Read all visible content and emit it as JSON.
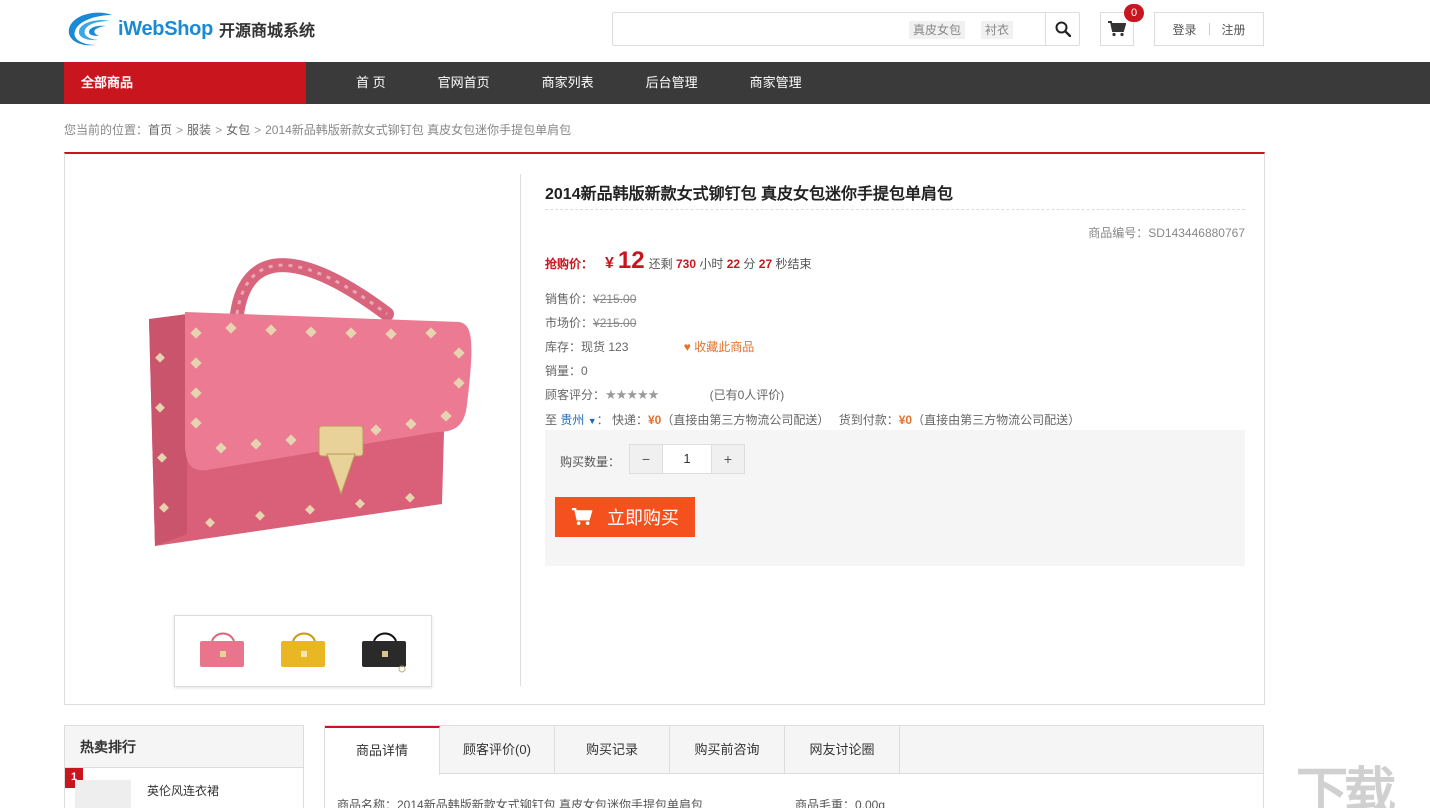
{
  "header": {
    "logo_brand": "iWebShop",
    "logo_sub": "开源商城系统",
    "search_placeholder": "",
    "search_tags": [
      "真皮女包",
      "衬衣"
    ],
    "cart_count": "0",
    "login": "登录",
    "register": "注册"
  },
  "nav": {
    "all_goods": "全部商品",
    "items": [
      "首 页",
      "官网首页",
      "商家列表",
      "后台管理",
      "商家管理"
    ]
  },
  "breadcrumb": {
    "prefix": "您当前的位置：",
    "items": [
      "首页",
      "服装",
      "女包"
    ],
    "current": "2014新品韩版新款女式铆钉包 真皮女包迷你手提包单肩包"
  },
  "product": {
    "title": "2014新品韩版新款女式铆钉包 真皮女包迷你手提包单肩包",
    "code_label": "商品编号：",
    "code": "SD143446880767",
    "rush_label": "抢购价：",
    "rush_currency": "¥",
    "rush_price": "12",
    "cd_prefix": "还剩",
    "cd_hours": "730",
    "cd_hours_unit": "小时",
    "cd_minutes": "22",
    "cd_minutes_unit": "分",
    "cd_seconds": "27",
    "cd_suffix": "秒结束",
    "sale_label": "销售价：",
    "sale_price": "¥215.00",
    "market_label": "市场价：",
    "market_price": "¥215.00",
    "stock_label": "库存：现货",
    "stock": "123",
    "favorite": "收藏此商品",
    "sold_label": "销量：",
    "sold": "0",
    "rating_label": "顾客评分：",
    "rating_stars": 5,
    "rating_text": "(已有0人评价)",
    "ship_to": "至",
    "region": "贵州",
    "express_label": "：  快递：",
    "express_fee": "¥0",
    "express_note": "（直接由第三方物流公司配送）",
    "cod_label": "货到付款：",
    "cod_fee": "¥0",
    "cod_note": "（直接由第三方物流公司配送）",
    "qty_label": "购买数量：",
    "qty_minus": "−",
    "qty_value": "1",
    "qty_plus": "+",
    "buy_now": "立即购买",
    "colors": {
      "bag_main": "#e8758c",
      "thumb_yellow": "#e9b624",
      "thumb_black": "#2a2a2a"
    }
  },
  "hot": {
    "title": "热卖排行",
    "items": [
      {
        "rank": "1",
        "name": "英伦风连衣裙"
      }
    ]
  },
  "tabs": {
    "items": [
      "商品详情",
      "顾客评价(0)",
      "购买记录",
      "购买前咨询",
      "网友讨论圈"
    ],
    "spec_name": "商品名称：2014新品韩版新款女式铆钉包 真皮女包迷你手提包单肩包",
    "spec_weight": "商品毛重：0.00g"
  },
  "colors": {
    "brand_red": "#c9151e",
    "buy_orange": "#f4511e",
    "nav_dark": "#3a3a3a",
    "logo_blue": "#1a8ad6"
  }
}
